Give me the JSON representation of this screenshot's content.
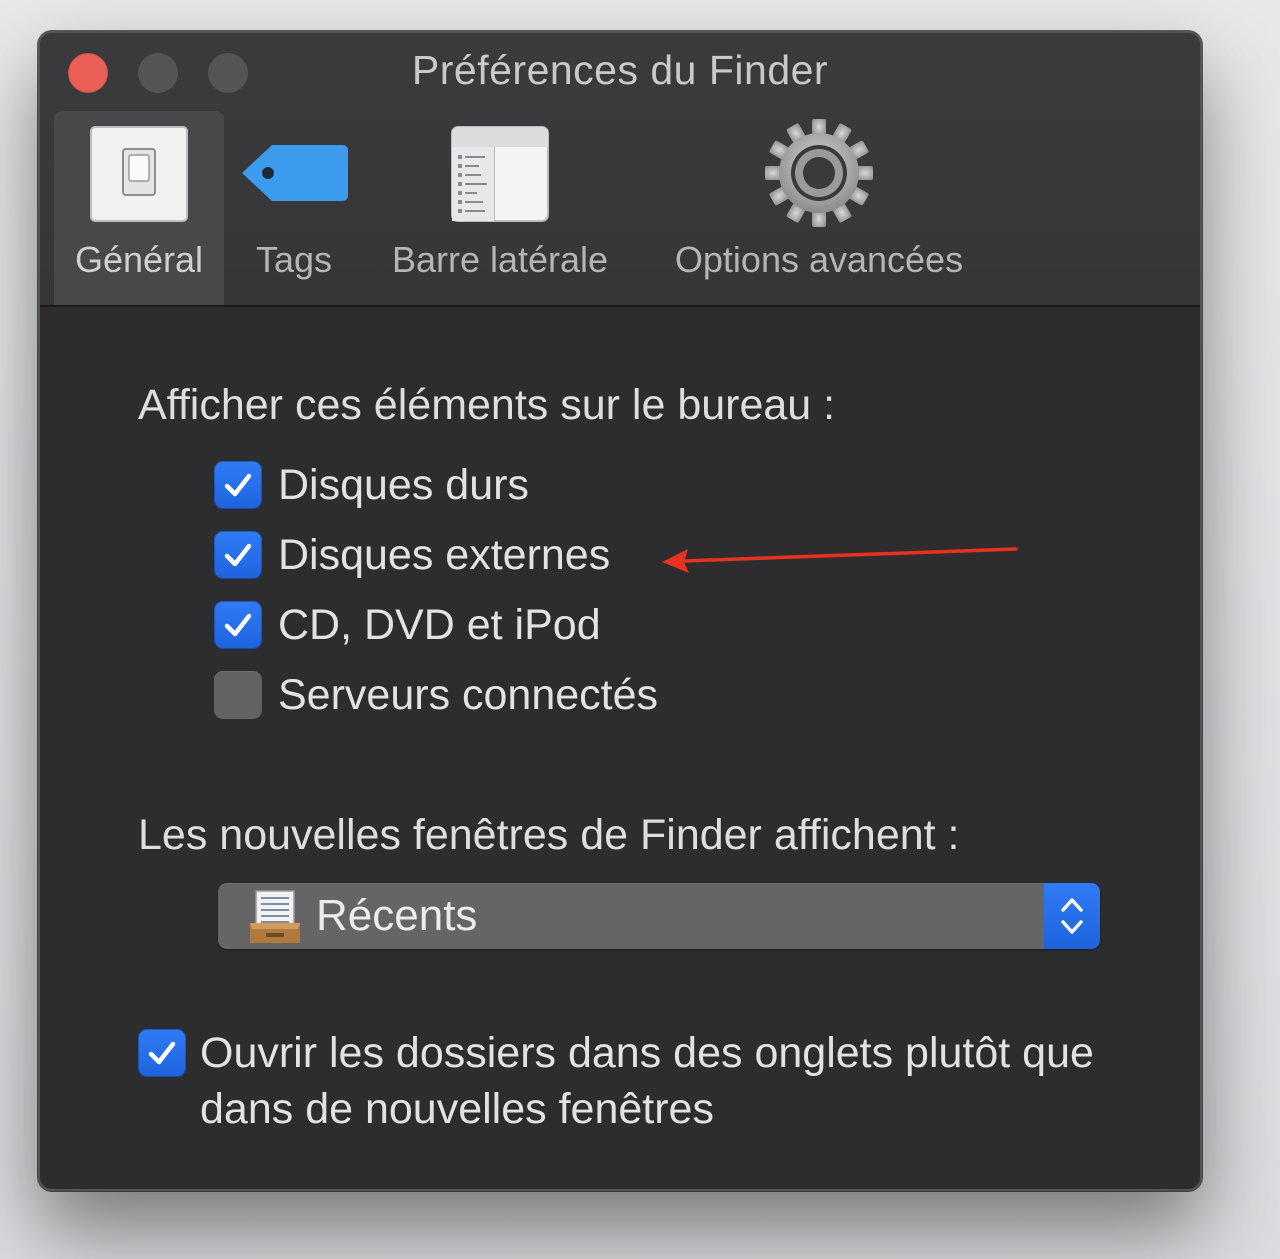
{
  "window": {
    "title": "Préférences du Finder"
  },
  "toolbar": {
    "tabs": [
      {
        "label": "Général",
        "icon": "general-switch-icon",
        "selected": true
      },
      {
        "label": "Tags",
        "icon": "tag-icon",
        "selected": false
      },
      {
        "label": "Barre latérale",
        "icon": "sidebar-icon",
        "selected": false
      },
      {
        "label": "Options avancées",
        "icon": "gear-icon",
        "selected": false
      }
    ]
  },
  "desktop_items": {
    "heading": "Afficher ces éléments sur le bureau :",
    "options": [
      {
        "label": "Disques durs",
        "checked": true
      },
      {
        "label": "Disques externes",
        "checked": true
      },
      {
        "label": "CD, DVD et iPod",
        "checked": true
      },
      {
        "label": "Serveurs connectés",
        "checked": false
      }
    ]
  },
  "new_windows": {
    "heading": "Les nouvelles fenêtres de Finder affichent :",
    "selected": "Récents",
    "icon": "recents-icon"
  },
  "tabs_option": {
    "label": "Ouvrir les dossiers dans des onglets plutôt que dans de nouvelles fenêtres",
    "checked": true
  },
  "colors": {
    "accent": "#2a73f0",
    "close": "#ec5f57",
    "window_bg": "#2d2d2f",
    "annotation_arrow": "#e8321f"
  }
}
